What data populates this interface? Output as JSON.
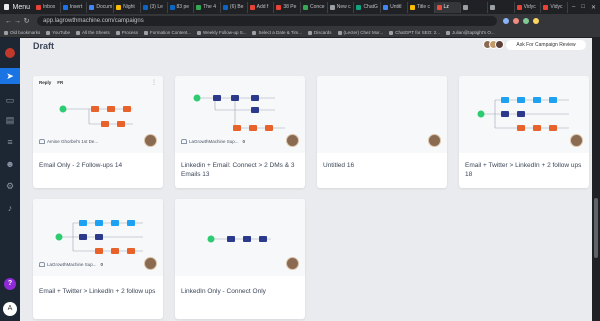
{
  "browser": {
    "menu_label": "Menu",
    "tabs": [
      {
        "label": "Inbox",
        "color": "#ea4335"
      },
      {
        "label": "Insert",
        "color": "#1a73e8"
      },
      {
        "label": "Docum",
        "color": "#4285f4"
      },
      {
        "label": "Night",
        "color": "#fbbc04"
      },
      {
        "label": "(3) Le",
        "color": "#0a66c2"
      },
      {
        "label": "83 pe",
        "color": "#0a66c2"
      },
      {
        "label": "The 4",
        "color": "#34a853"
      },
      {
        "label": "(6) Be",
        "color": "#0a66c2"
      },
      {
        "label": "Add f",
        "color": "#ea4335"
      },
      {
        "label": "38 Pe",
        "color": "#ea4335"
      },
      {
        "label": "Conce",
        "color": "#34a853"
      },
      {
        "label": "New c",
        "color": "#9aa0a6"
      },
      {
        "label": "ChatG",
        "color": "#10a37f"
      },
      {
        "label": "Untitl",
        "color": "#4285f4"
      },
      {
        "label": "Title c",
        "color": "#fbbc04"
      },
      {
        "label": "Lz",
        "color": "#e74c3c",
        "active": true
      },
      {
        "label": "",
        "color": "#9aa0a6"
      },
      {
        "label": "",
        "color": "#9aa0a6"
      },
      {
        "label": "Vidyc",
        "color": "#ea4335"
      },
      {
        "label": "Vidyc",
        "color": "#ea4335"
      }
    ],
    "url": "app.lagrowthmachine.com/campaigns",
    "bookmarks": [
      "Old bookmarks",
      "YouTube",
      "All the Sheets",
      "Process",
      "Formation Content...",
      "Weekly Follow-up S...",
      "Select a Date & Tim...",
      "Discards",
      "(Lecter) Chez Mor...",
      "ChatGPT for SEO: 2...",
      "Julian@taptight's O..."
    ]
  },
  "page": {
    "section_title": "Draft",
    "review_button": "Ask For Campaign Review"
  },
  "cards": [
    {
      "title": "Email Only - 2 Follow-ups 14",
      "owner": "Amine Ghorbel's 1st De...",
      "count": "",
      "hover": {
        "reply": "Reply",
        "lang": "FR"
      }
    },
    {
      "title": "Linkedin + Email: Connect > 2 DMs & 3 Emails 13",
      "owner": "LaGrowthMachine Sup...",
      "count": "0"
    },
    {
      "title": "Untitled 16",
      "owner": "",
      "count": ""
    },
    {
      "title": "Email + Twitter > LinkedIn + 2 follow ups 18",
      "owner": "",
      "count": ""
    },
    {
      "title": "Email + Twitter > LinkedIn + 2 follow ups",
      "owner": "LaGrowthMachine Sup...",
      "count": "0"
    },
    {
      "title": "LinkedIn Only - Connect Only",
      "owner": "",
      "count": ""
    }
  ],
  "colors": {
    "start_node": "#2ecc71",
    "linkedin_node": "#2d3a8c",
    "email_node": "#e8622c",
    "twitter_node": "#1da1f2",
    "sidebar": "#1d2633",
    "accent": "#1b74e4"
  }
}
